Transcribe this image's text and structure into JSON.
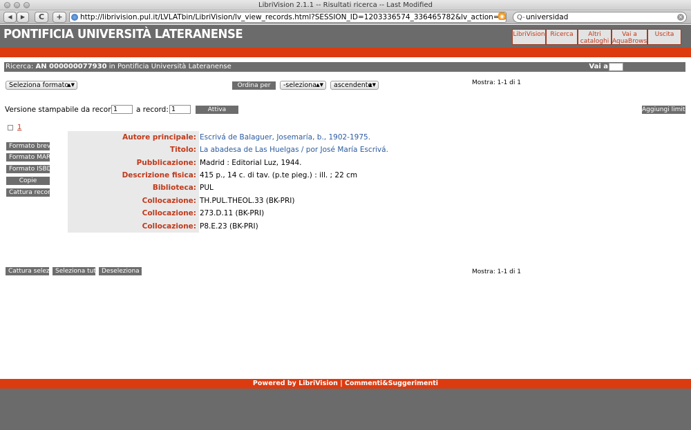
{
  "window": {
    "title": "LibriVision 2.1.1 -- Risultati ricerca -- Last Modified",
    "url": "http://librivision.pul.it/LVLATbin/LibriVision/lv_view_records.html?SESSION_ID=1203336574_336465782&lv_action=LV_View_Records&NR_RECO",
    "search_text": "universidad",
    "back_label": "◀",
    "forward_label": "▶",
    "reload_label": "C",
    "add_label": "+",
    "search_prefix": "Q-"
  },
  "header": {
    "logo": "PONTIFICIA UNIVERSITÀ LATERANENSE",
    "nav": [
      {
        "label": "LibriVision"
      },
      {
        "label": "Ricerca"
      },
      {
        "label": "Altri cataloghi"
      },
      {
        "label": "Vai a AquaBrowser"
      },
      {
        "label": "Uscita"
      }
    ]
  },
  "search_bar": {
    "prefix": "Ricerca:",
    "query": "AN 000000077930",
    "scope": "in Pontificia Università Lateranense",
    "goto_label": "Vai a"
  },
  "controls": {
    "format_select": "Seleziona formato",
    "ordina_per": "Ordina per",
    "order_select": "-seleziona-",
    "direction_select": "ascendente",
    "mostra_top": "Mostra: 1-1 di 1",
    "print_label": "Versione stampabile da record:",
    "from_value": "1",
    "to_label": "a record:",
    "to_value": "1",
    "attiva": "Attiva",
    "aggiungi_limiti": "Aggiungi limiti"
  },
  "record": {
    "number": "1",
    "side_buttons": [
      "Formato breve",
      "Formato MARC",
      "Formato ISBD",
      "Copie",
      "Cattura record"
    ],
    "fields": [
      {
        "label": "Autore principale:",
        "value": "Escrivá de Balaguer, Josemaría, b., 1902-1975.",
        "link": true
      },
      {
        "label": "Titolo:",
        "value": "La abadesa de Las Huelgas / por José María Escrivá.",
        "link": true
      },
      {
        "label": "Pubblicazione:",
        "value": "Madrid : Editorial Luz, 1944.",
        "link": false
      },
      {
        "label": "Descrizione fisica:",
        "value": "415 p., 14 c. di tav. (p.te pieg.) : ill. ; 22 cm",
        "link": false
      },
      {
        "label": "Biblioteca:",
        "value": "PUL",
        "link": false
      },
      {
        "label": "Collocazione:",
        "value": "TH.PUL.THEOL.33 (BK-PRI)",
        "link": false
      },
      {
        "label": "Collocazione:",
        "value": "273.D.11 (BK-PRI)",
        "link": false
      },
      {
        "label": "Collocazione:",
        "value": "P8.E.23 (BK-PRI)",
        "link": false
      }
    ]
  },
  "bottom": {
    "buttons": [
      "Cattura selezionati",
      "Seleziona tutti",
      "Deseleziona tutti"
    ],
    "mostra": "Mostra: 1-1 di 1"
  },
  "footer": {
    "powered": "Powered by LibriVision",
    "separator": "|",
    "comments": "Commenti&Suggerimenti"
  }
}
